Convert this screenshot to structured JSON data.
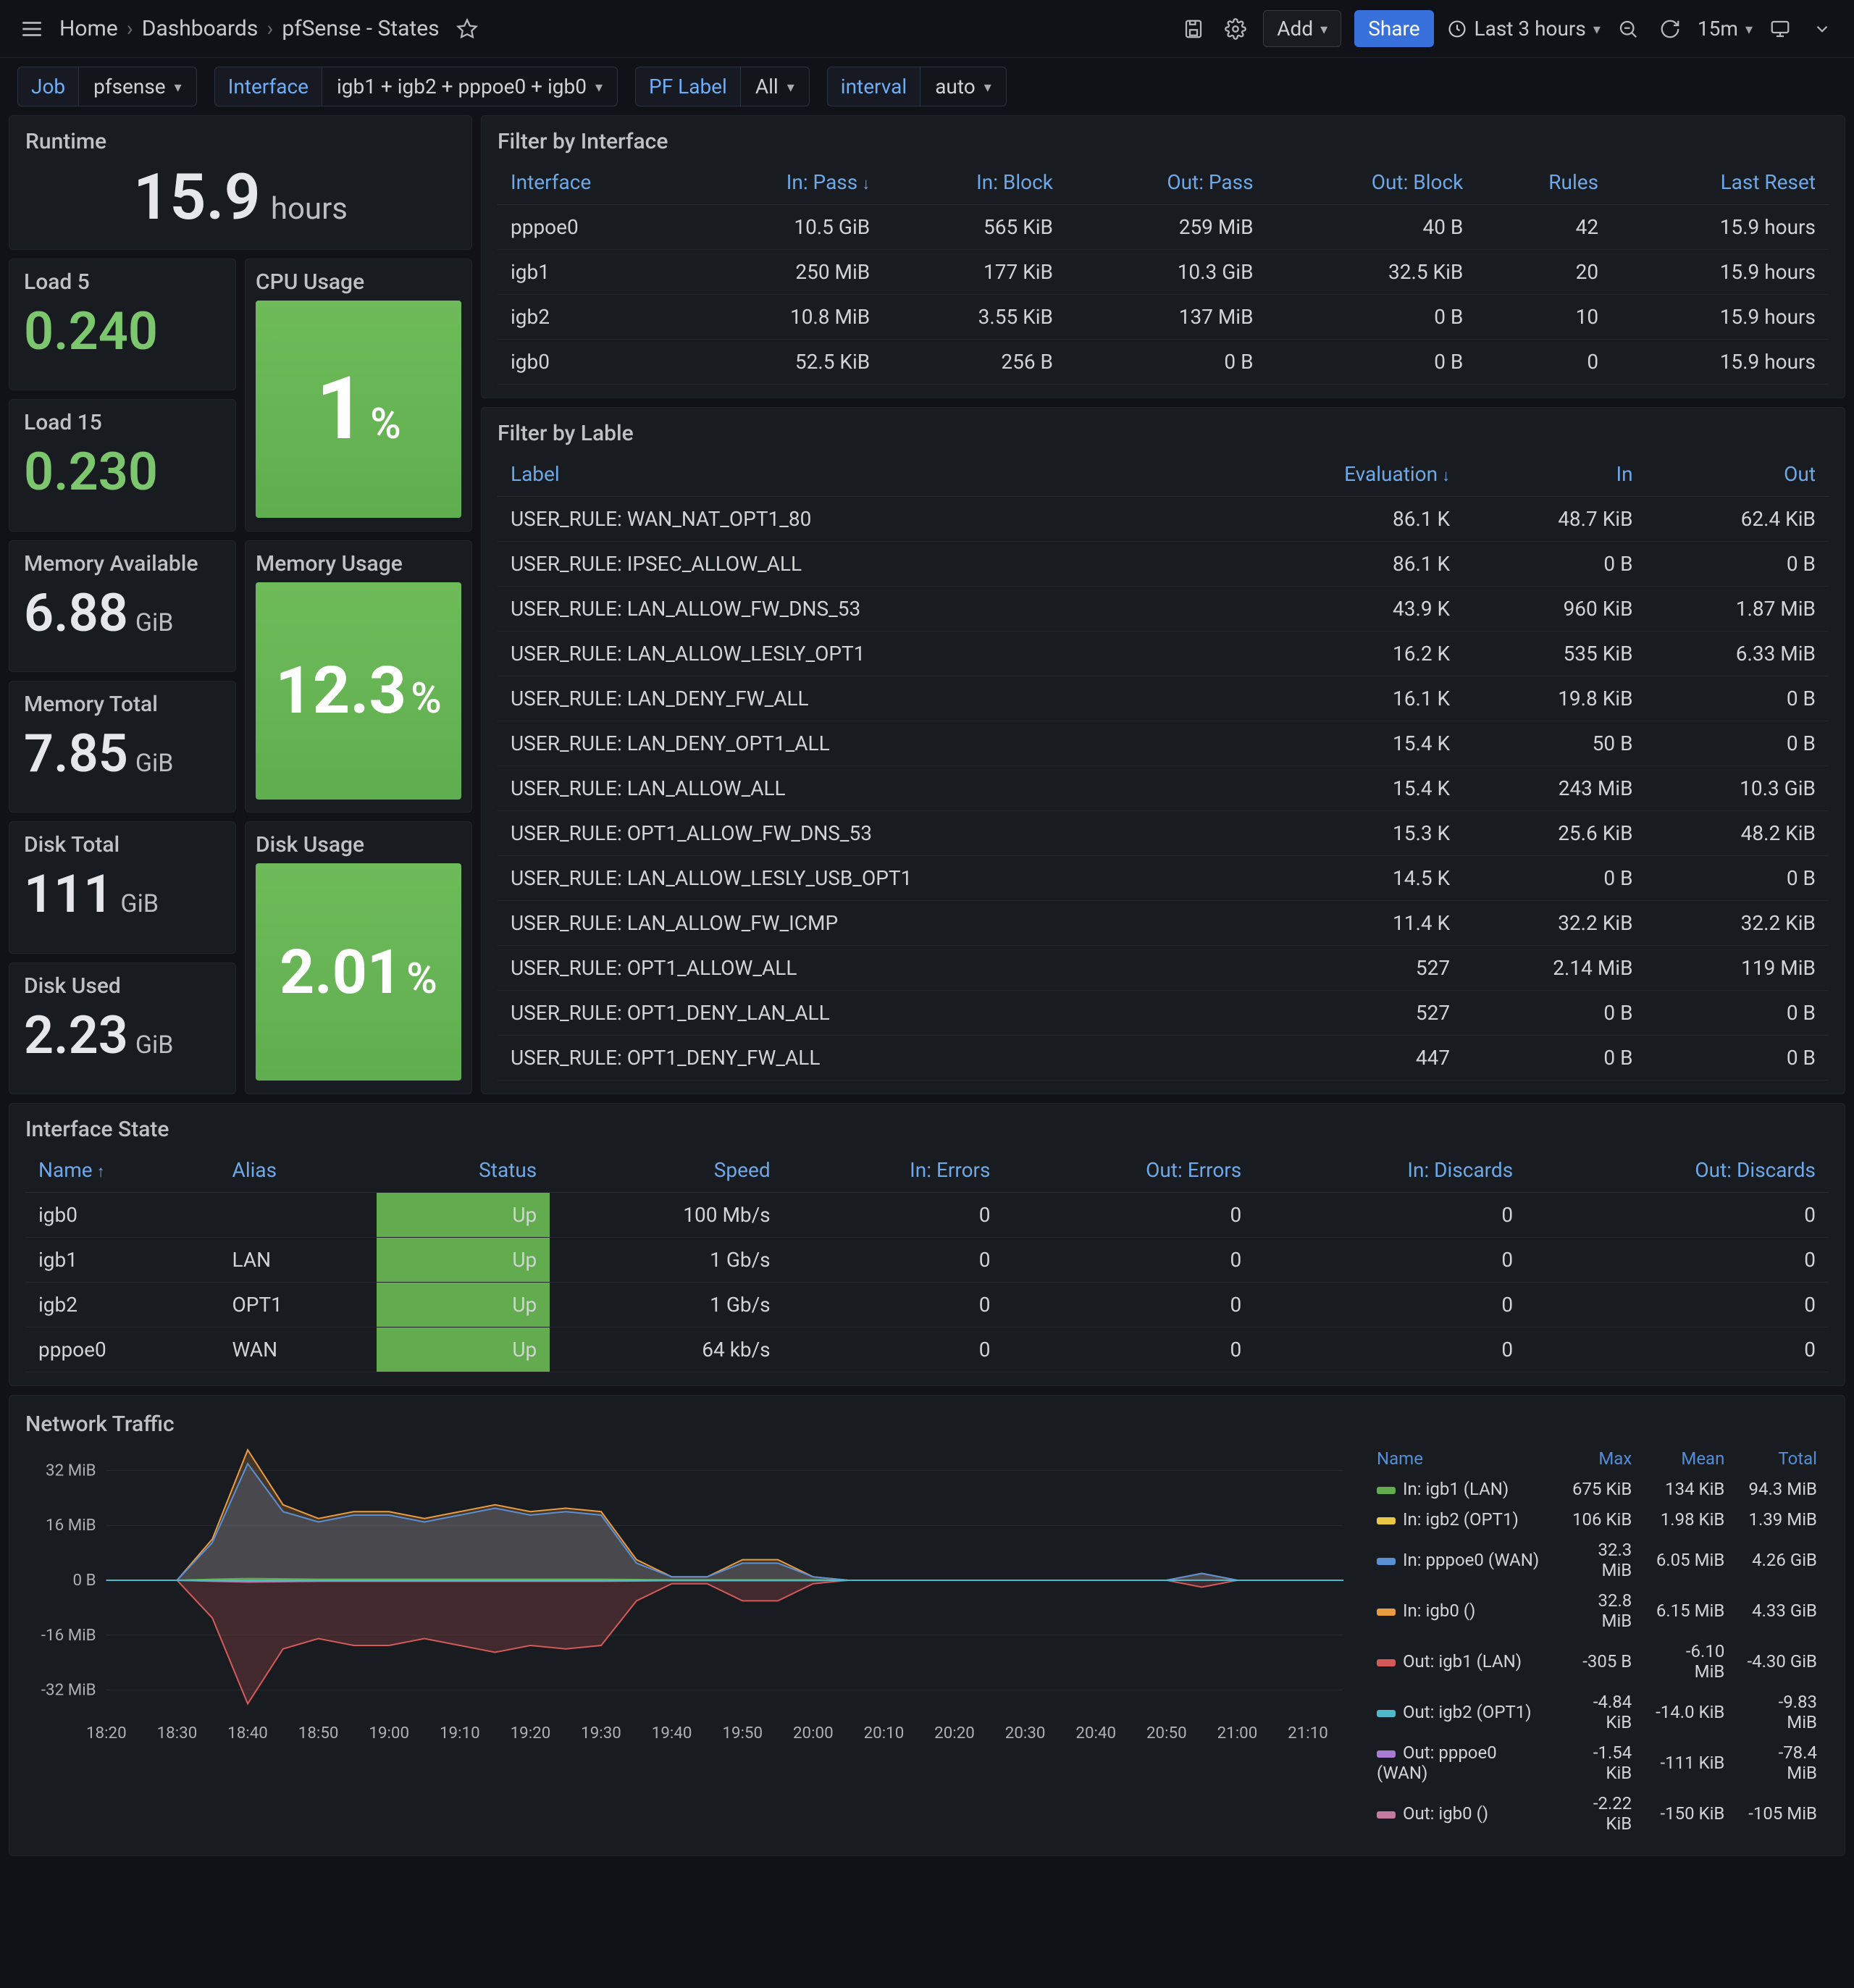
{
  "topbar": {
    "breadcrumb": [
      "Home",
      "Dashboards",
      "pfSense - States"
    ],
    "add_label": "Add",
    "share_label": "Share",
    "time_range_label": "Last 3 hours",
    "refresh_interval": "15m"
  },
  "variables": {
    "job": {
      "label": "Job",
      "value": "pfsense"
    },
    "interface": {
      "label": "Interface",
      "value": "igb1 + igb2 + pppoe0 + igb0"
    },
    "pf_label": {
      "label": "PF Label",
      "value": "All"
    },
    "interval": {
      "label": "interval",
      "value": "auto"
    }
  },
  "stats": {
    "runtime": {
      "title": "Runtime",
      "value": "15.9",
      "unit": "hours"
    },
    "load5": {
      "title": "Load 5",
      "value": "0.240"
    },
    "load15": {
      "title": "Load 15",
      "value": "0.230"
    },
    "cpu": {
      "title": "CPU Usage",
      "value": "1",
      "unit": "%"
    },
    "memory_available": {
      "title": "Memory Available",
      "value": "6.88",
      "unit": "GiB"
    },
    "memory_total": {
      "title": "Memory Total",
      "value": "7.85",
      "unit": "GiB"
    },
    "memory_usage": {
      "title": "Memory Usage",
      "value": "12.3",
      "unit": "%"
    },
    "disk_total": {
      "title": "Disk Total",
      "value": "111",
      "unit": "GiB"
    },
    "disk_used": {
      "title": "Disk Used",
      "value": "2.23",
      "unit": "GiB"
    },
    "disk_usage": {
      "title": "Disk Usage",
      "value": "2.01",
      "unit": "%"
    }
  },
  "table_interface": {
    "title": "Filter by Interface",
    "headers": [
      "Interface",
      "In: Pass",
      "In: Block",
      "Out: Pass",
      "Out: Block",
      "Rules",
      "Last Reset"
    ],
    "sort_col": 1,
    "rows": [
      [
        "pppoe0",
        "10.5 GiB",
        "565 KiB",
        "259 MiB",
        "40 B",
        "42",
        "15.9 hours"
      ],
      [
        "igb1",
        "250 MiB",
        "177 KiB",
        "10.3 GiB",
        "32.5 KiB",
        "20",
        "15.9 hours"
      ],
      [
        "igb2",
        "10.8 MiB",
        "3.55 KiB",
        "137 MiB",
        "0 B",
        "10",
        "15.9 hours"
      ],
      [
        "igb0",
        "52.5 KiB",
        "256 B",
        "0 B",
        "0 B",
        "0",
        "15.9 hours"
      ]
    ]
  },
  "table_label": {
    "title": "Filter by Lable",
    "headers": [
      "Label",
      "Evaluation",
      "In",
      "Out"
    ],
    "sort_col": 1,
    "rows": [
      [
        "USER_RULE: WAN_NAT_OPT1_80",
        "86.1 K",
        "48.7 KiB",
        "62.4 KiB"
      ],
      [
        "USER_RULE: IPSEC_ALLOW_ALL",
        "86.1 K",
        "0 B",
        "0 B"
      ],
      [
        "USER_RULE: LAN_ALLOW_FW_DNS_53",
        "43.9 K",
        "960 KiB",
        "1.87 MiB"
      ],
      [
        "USER_RULE: LAN_ALLOW_LESLY_OPT1",
        "16.2 K",
        "535 KiB",
        "6.33 MiB"
      ],
      [
        "USER_RULE: LAN_DENY_FW_ALL",
        "16.1 K",
        "19.8 KiB",
        "0 B"
      ],
      [
        "USER_RULE: LAN_DENY_OPT1_ALL",
        "15.4 K",
        "50 B",
        "0 B"
      ],
      [
        "USER_RULE: LAN_ALLOW_ALL",
        "15.4 K",
        "243 MiB",
        "10.3 GiB"
      ],
      [
        "USER_RULE: OPT1_ALLOW_FW_DNS_53",
        "15.3 K",
        "25.6 KiB",
        "48.2 KiB"
      ],
      [
        "USER_RULE: LAN_ALLOW_LESLY_USB_OPT1",
        "14.5 K",
        "0 B",
        "0 B"
      ],
      [
        "USER_RULE: LAN_ALLOW_FW_ICMP",
        "11.4 K",
        "32.2 KiB",
        "32.2 KiB"
      ],
      [
        "USER_RULE: OPT1_ALLOW_ALL",
        "527",
        "2.14 MiB",
        "119 MiB"
      ],
      [
        "USER_RULE: OPT1_DENY_LAN_ALL",
        "527",
        "0 B",
        "0 B"
      ],
      [
        "USER_RULE: OPT1_DENY_FW_ALL",
        "447",
        "0 B",
        "0 B"
      ]
    ]
  },
  "table_ifstate": {
    "title": "Interface State",
    "headers": [
      "Name",
      "Alias",
      "Status",
      "Speed",
      "In: Errors",
      "Out: Errors",
      "In: Discards",
      "Out: Discards"
    ],
    "sort_col": 0,
    "rows": [
      {
        "name": "igb0",
        "alias": "",
        "status": "Up",
        "speed": "100 Mb/s",
        "speed_class": "speed-100",
        "in_err": "0",
        "out_err": "0",
        "in_disc": "0",
        "out_disc": "0"
      },
      {
        "name": "igb1",
        "alias": "LAN",
        "status": "Up",
        "speed": "1 Gb/s",
        "speed_class": "speed-1g",
        "in_err": "0",
        "out_err": "0",
        "in_disc": "0",
        "out_disc": "0"
      },
      {
        "name": "igb2",
        "alias": "OPT1",
        "status": "Up",
        "speed": "1 Gb/s",
        "speed_class": "speed-1g",
        "in_err": "0",
        "out_err": "0",
        "in_disc": "0",
        "out_disc": "0"
      },
      {
        "name": "pppoe0",
        "alias": "WAN",
        "status": "Up",
        "speed": "64 kb/s",
        "speed_class": "",
        "in_err": "0",
        "out_err": "0",
        "in_disc": "0",
        "out_disc": "0"
      }
    ]
  },
  "traffic": {
    "title": "Network Traffic",
    "legend_headers": [
      "Name",
      "Max",
      "Mean",
      "Total"
    ],
    "series": [
      {
        "swatch": "sw-ingb1",
        "name": "In: igb1 (LAN)",
        "max": "675 KiB",
        "mean": "134 KiB",
        "total": "94.3 MiB"
      },
      {
        "swatch": "sw-inigb2",
        "name": "In: igb2 (OPT1)",
        "max": "106 KiB",
        "mean": "1.98 KiB",
        "total": "1.39 MiB"
      },
      {
        "swatch": "sw-inppp",
        "name": "In: pppoe0 (WAN)",
        "max": "32.3 MiB",
        "mean": "6.05 MiB",
        "total": "4.26 GiB"
      },
      {
        "swatch": "sw-inigb0",
        "name": "In: igb0 ()",
        "max": "32.8 MiB",
        "mean": "6.15 MiB",
        "total": "4.33 GiB"
      },
      {
        "swatch": "sw-outigb1",
        "name": "Out: igb1 (LAN)",
        "max": "-305 B",
        "mean": "-6.10 MiB",
        "total": "-4.30 GiB"
      },
      {
        "swatch": "sw-outigb2",
        "name": "Out: igb2 (OPT1)",
        "max": "-4.84 KiB",
        "mean": "-14.0 KiB",
        "total": "-9.83 MiB"
      },
      {
        "swatch": "sw-outppp",
        "name": "Out: pppoe0 (WAN)",
        "max": "-1.54 KiB",
        "mean": "-111 KiB",
        "total": "-78.4 MiB"
      },
      {
        "swatch": "sw-outigb0",
        "name": "Out: igb0 ()",
        "max": "-2.22 KiB",
        "mean": "-150 KiB",
        "total": "-105 MiB"
      }
    ]
  },
  "chart_data": {
    "type": "area",
    "title": "Network Traffic",
    "xlabel": "",
    "ylabel": "",
    "x_ticks": [
      "18:20",
      "18:30",
      "18:40",
      "18:50",
      "19:00",
      "19:10",
      "19:20",
      "19:30",
      "19:40",
      "19:50",
      "20:00",
      "20:10",
      "20:20",
      "20:30",
      "20:40",
      "20:50",
      "21:00",
      "21:10"
    ],
    "y_ticks": [
      "-32 MiB",
      "-16 MiB",
      "0 B",
      "16 MiB",
      "32 MiB"
    ],
    "ylim": [
      -38,
      38
    ],
    "x": [
      "18:20",
      "18:25",
      "18:30",
      "18:35",
      "18:40",
      "18:45",
      "18:50",
      "18:55",
      "19:00",
      "19:05",
      "19:10",
      "19:15",
      "19:20",
      "19:25",
      "19:30",
      "19:35",
      "19:40",
      "19:45",
      "19:50",
      "19:55",
      "20:00",
      "20:05",
      "20:10",
      "20:15",
      "20:20",
      "20:25",
      "20:30",
      "20:35",
      "20:40",
      "20:45",
      "20:50",
      "20:55",
      "21:00",
      "21:05",
      "21:10",
      "21:15"
    ],
    "series": [
      {
        "name": "In: igb0 ()",
        "color": "#e89b41",
        "values": [
          0,
          0,
          0,
          12,
          38,
          22,
          18,
          20,
          20,
          18,
          20,
          22,
          20,
          21,
          20,
          6,
          1,
          1,
          6,
          6,
          1,
          0,
          0,
          0,
          0,
          0,
          0,
          0,
          0,
          0,
          0,
          2,
          0,
          0,
          0,
          0
        ]
      },
      {
        "name": "In: pppoe0 (WAN)",
        "color": "#5a8fd6",
        "values": [
          0,
          0,
          0,
          11,
          34,
          20,
          17,
          19,
          19,
          17,
          19,
          21,
          19,
          20,
          19,
          5,
          1,
          1,
          5,
          5,
          1,
          0,
          0,
          0,
          0,
          0,
          0,
          0,
          0,
          0,
          0,
          2,
          0,
          0,
          0,
          0
        ]
      },
      {
        "name": "In: igb1 (LAN)",
        "color": "#62ac4f",
        "values": [
          0,
          0,
          0,
          0.3,
          0.5,
          0.4,
          0.3,
          0.3,
          0.3,
          0.3,
          0.3,
          0.3,
          0.3,
          0.3,
          0.3,
          0.2,
          0.1,
          0.1,
          0.1,
          0.1,
          0.1,
          0,
          0,
          0,
          0,
          0,
          0,
          0,
          0,
          0,
          0,
          0,
          0,
          0,
          0,
          0
        ]
      },
      {
        "name": "In: igb2 (OPT1)",
        "color": "#e9c744",
        "values": [
          0,
          0,
          0,
          0,
          0,
          0,
          0,
          0,
          0,
          0,
          0,
          0,
          0,
          0,
          0,
          0,
          0,
          0,
          0,
          0,
          0,
          0,
          0,
          0,
          0,
          0,
          0,
          0,
          0,
          0,
          0,
          0,
          0,
          0,
          0,
          0
        ]
      },
      {
        "name": "Out: igb1 (LAN)",
        "color": "#d45a5a",
        "values": [
          0,
          0,
          0,
          -11,
          -36,
          -20,
          -17,
          -19,
          -19,
          -17,
          -19,
          -21,
          -19,
          -20,
          -19,
          -6,
          -1,
          -1,
          -6,
          -6,
          -1,
          0,
          0,
          0,
          0,
          0,
          0,
          0,
          0,
          0,
          0,
          -2,
          0,
          0,
          0,
          0
        ]
      },
      {
        "name": "Out: pppoe0 (WAN)",
        "color": "#a77bd0",
        "values": [
          0,
          0,
          0,
          -0.2,
          -0.4,
          -0.3,
          -0.2,
          -0.2,
          -0.2,
          -0.2,
          -0.2,
          -0.2,
          -0.2,
          -0.2,
          -0.2,
          -0.1,
          -0.05,
          -0.05,
          -0.1,
          -0.1,
          -0.05,
          0,
          0,
          0,
          0,
          0,
          0,
          0,
          0,
          0,
          0,
          0,
          0,
          0,
          0,
          0
        ]
      },
      {
        "name": "Out: igb0 ()",
        "color": "#c27aa0",
        "values": [
          0,
          0,
          0,
          -0.3,
          -0.5,
          -0.4,
          -0.3,
          -0.3,
          -0.3,
          -0.3,
          -0.3,
          -0.3,
          -0.3,
          -0.3,
          -0.3,
          -0.2,
          -0.1,
          -0.1,
          -0.1,
          -0.1,
          -0.1,
          0,
          0,
          0,
          0,
          0,
          0,
          0,
          0,
          0,
          0,
          0,
          0,
          0,
          0,
          0
        ]
      },
      {
        "name": "Out: igb2 (OPT1)",
        "color": "#4fb8c9",
        "values": [
          0,
          0,
          0,
          0,
          0,
          0,
          0,
          0,
          0,
          0,
          0,
          0,
          0,
          0,
          0,
          0,
          0,
          0,
          0,
          0,
          0,
          0,
          0,
          0,
          0,
          0,
          0,
          0,
          0,
          0,
          0,
          0,
          0,
          0,
          0,
          0
        ]
      }
    ]
  }
}
